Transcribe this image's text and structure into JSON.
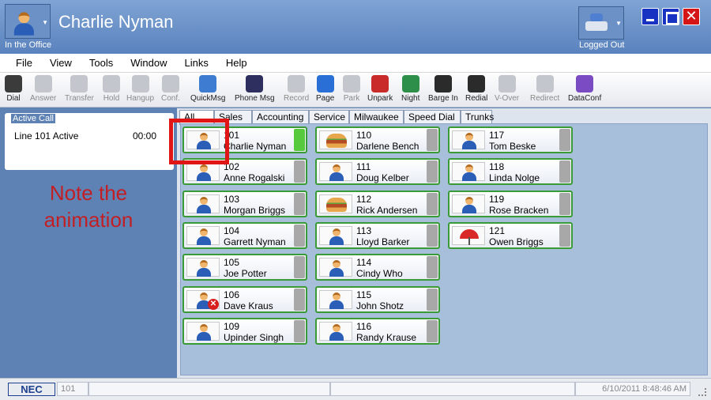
{
  "window": {
    "user_name": "Charlie Nyman",
    "presence_status": "In the Office",
    "login_status": "Logged Out",
    "controls": {
      "minimize": "minimize",
      "maximize": "maximize",
      "close": "✕"
    }
  },
  "menu": [
    "File",
    "View",
    "Tools",
    "Window",
    "Links",
    "Help"
  ],
  "toolbar": [
    {
      "label": "Dial",
      "enabled": true,
      "icon": "dialpad-icon",
      "color": "#3b3b3b"
    },
    {
      "label": "Answer",
      "enabled": false,
      "icon": "handset-icon"
    },
    {
      "label": "Transfer",
      "enabled": false,
      "icon": "transfer-icon"
    },
    {
      "label": "Hold",
      "enabled": false,
      "icon": "hold-icon"
    },
    {
      "label": "Hangup",
      "enabled": false,
      "icon": "hangup-icon"
    },
    {
      "label": "Conf.",
      "enabled": false,
      "icon": "conference-icon"
    },
    {
      "label": "QuickMsg",
      "enabled": true,
      "icon": "quickmsg-icon",
      "color": "#3d7cd1"
    },
    {
      "label": "Phone Msg",
      "enabled": true,
      "icon": "phone-msg-icon",
      "color": "#2f2f5f"
    },
    {
      "label": "Record",
      "enabled": false,
      "icon": "record-icon"
    },
    {
      "label": "Page",
      "enabled": true,
      "icon": "page-speaker-icon",
      "color": "#2a6fd6"
    },
    {
      "label": "Park",
      "enabled": false,
      "icon": "park-icon"
    },
    {
      "label": "Unpark",
      "enabled": true,
      "icon": "unpark-icon",
      "color": "#c92b2b"
    },
    {
      "label": "Night",
      "enabled": true,
      "icon": "night-globe-icon",
      "color": "#2e8f4a"
    },
    {
      "label": "Barge In",
      "enabled": true,
      "icon": "barge-in-icon",
      "color": "#2b2b2b"
    },
    {
      "label": "Redial",
      "enabled": true,
      "icon": "redial-icon",
      "color": "#2b2b2b"
    },
    {
      "label": "V-Over",
      "enabled": false,
      "icon": "voice-over-icon"
    },
    {
      "label": "Redirect",
      "enabled": false,
      "icon": "redirect-icon"
    },
    {
      "label": "DataConf",
      "enabled": true,
      "icon": "data-conf-icon",
      "color": "#7a4bc2"
    }
  ],
  "active_call": {
    "title": "Active Call",
    "line_text": "Line 101 Active",
    "timer": "00:00"
  },
  "annotation": {
    "line1": "Note the",
    "line2": "animation"
  },
  "tabs": [
    "All",
    "Sales",
    "Accounting",
    "Service",
    "Milwaukee",
    "Speed Dial",
    "Trunks"
  ],
  "active_tab": "All",
  "extensions": [
    {
      "ext": "101",
      "name": "Charlie Nyman",
      "icon": "person-icon",
      "status": "green"
    },
    {
      "ext": "102",
      "name": "Anne Rogalski",
      "icon": "person-icon",
      "status": "gray"
    },
    {
      "ext": "103",
      "name": "Morgan Briggs",
      "icon": "person-icon",
      "status": "gray"
    },
    {
      "ext": "104",
      "name": "Garrett Nyman",
      "icon": "person-icon",
      "status": "gray"
    },
    {
      "ext": "105",
      "name": "Joe Potter",
      "icon": "person-icon",
      "status": "gray"
    },
    {
      "ext": "106",
      "name": "Dave Kraus",
      "icon": "person-dnd-icon",
      "status": "gray"
    },
    {
      "ext": "109",
      "name": "Upinder Singh",
      "icon": "person-icon",
      "status": "gray"
    },
    {
      "ext": "110",
      "name": "Darlene Bench",
      "icon": "burger-icon",
      "status": "gray"
    },
    {
      "ext": "111",
      "name": "Doug Kelber",
      "icon": "person-icon",
      "status": "gray"
    },
    {
      "ext": "112",
      "name": "Rick Andersen",
      "icon": "burger-icon",
      "status": "gray"
    },
    {
      "ext": "113",
      "name": "Lloyd Barker",
      "icon": "person-icon",
      "status": "gray"
    },
    {
      "ext": "114",
      "name": "Cindy Who",
      "icon": "person-icon",
      "status": "gray"
    },
    {
      "ext": "115",
      "name": "John Shotz",
      "icon": "person-icon",
      "status": "gray"
    },
    {
      "ext": "116",
      "name": "Randy Krause",
      "icon": "person-icon",
      "status": "gray"
    },
    {
      "ext": "117",
      "name": "Tom Beske",
      "icon": "person-icon",
      "status": "gray"
    },
    {
      "ext": "118",
      "name": "Linda Nolge",
      "icon": "person-icon",
      "status": "gray"
    },
    {
      "ext": "119",
      "name": "Rose Bracken",
      "icon": "person-icon",
      "status": "gray"
    },
    {
      "ext": "121",
      "name": "Owen Briggs",
      "icon": "umbrella-icon",
      "status": "gray"
    }
  ],
  "statusbar": {
    "brand": "NEC",
    "extension": "101",
    "datetime": "6/10/2011 8:48:46 AM"
  }
}
